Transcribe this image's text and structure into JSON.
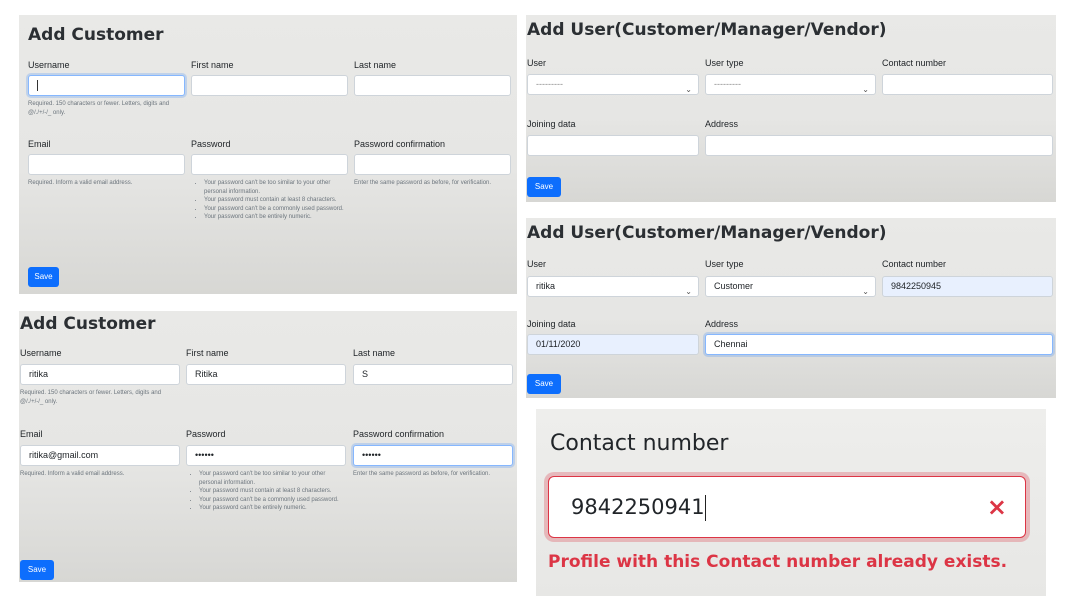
{
  "add_customer_empty": {
    "title": "Add Customer",
    "username_label": "Username",
    "first_name_label": "First name",
    "last_name_label": "Last name",
    "username_help": "Required. 150 characters or fewer. Letters, digits and @/./+/-/_ only.",
    "email_label": "Email",
    "password_label": "Password",
    "password_confirmation_label": "Password confirmation",
    "email_help": "Required. Inform a valid email address.",
    "password_help": [
      "Your password can't be too similar to your other personal information.",
      "Your password must contain at least 8 characters.",
      "Your password can't be a commonly used password.",
      "Your password can't be entirely numeric."
    ],
    "password_confirmation_help": "Enter the same password as before, for verification.",
    "save_label": "Save"
  },
  "add_customer_filled": {
    "title": "Add Customer",
    "username_label": "Username",
    "first_name_label": "First name",
    "last_name_label": "Last name",
    "username_value": "ritika",
    "first_name_value": "Ritika",
    "last_name_value": "S",
    "username_help": "Required. 150 characters or fewer. Letters, digits and @/./+/-/_ only.",
    "email_label": "Email",
    "password_label": "Password",
    "password_confirmation_label": "Password confirmation",
    "email_value": "ritika@gmail.com",
    "password_value": "••••••",
    "password_confirmation_value": "••••••",
    "email_help": "Required. Inform a valid email address.",
    "password_help": [
      "Your password can't be too similar to your other personal information.",
      "Your password must contain at least 8 characters.",
      "Your password can't be a commonly used password.",
      "Your password can't be entirely numeric."
    ],
    "password_confirmation_help": "Enter the same password as before, for verification.",
    "save_label": "Save"
  },
  "add_user_empty": {
    "title": "Add User(Customer/Manager/Vendor)",
    "user_label": "User",
    "user_type_label": "User type",
    "contact_label": "Contact number",
    "user_value": "---------",
    "user_type_value": "---------",
    "joining_label": "Joining data",
    "address_label": "Address",
    "save_label": "Save"
  },
  "add_user_filled": {
    "title": "Add User(Customer/Manager/Vendor)",
    "user_label": "User",
    "user_type_label": "User type",
    "contact_label": "Contact number",
    "user_value": "ritika",
    "user_type_value": "Customer",
    "contact_value": "9842250945",
    "joining_label": "Joining data",
    "address_label": "Address",
    "joining_value": "01/11/2020",
    "address_value": "Chennai",
    "save_label": "Save"
  },
  "contact_error": {
    "label": "Contact number",
    "value": "9842250941",
    "clear_icon": "×",
    "error_message": "Profile with this Contact number already exists."
  },
  "colors": {
    "primary": "#0d6efd",
    "danger": "#dc3545",
    "focus_border": "#86b7fe",
    "autofill_bg": "#e8f0fe"
  }
}
